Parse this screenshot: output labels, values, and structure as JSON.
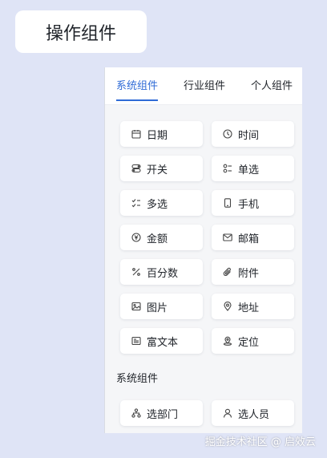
{
  "header": {
    "title": "操作组件"
  },
  "tabs": [
    {
      "label": "系统组件",
      "active": true
    },
    {
      "label": "行业组件",
      "active": false
    },
    {
      "label": "个人组件",
      "active": false
    }
  ],
  "components": [
    {
      "label": "日期",
      "icon": "calendar-icon"
    },
    {
      "label": "时间",
      "icon": "clock-icon"
    },
    {
      "label": "开关",
      "icon": "toggle-icon"
    },
    {
      "label": "单选",
      "icon": "radio-icon"
    },
    {
      "label": "多选",
      "icon": "checkbox-icon"
    },
    {
      "label": "手机",
      "icon": "phone-icon"
    },
    {
      "label": "金额",
      "icon": "yen-icon"
    },
    {
      "label": "邮箱",
      "icon": "mail-icon"
    },
    {
      "label": "百分数",
      "icon": "percent-icon"
    },
    {
      "label": "附件",
      "icon": "paperclip-icon"
    },
    {
      "label": "图片",
      "icon": "image-icon"
    },
    {
      "label": "地址",
      "icon": "location-icon"
    },
    {
      "label": "富文本",
      "icon": "rich-text-icon"
    },
    {
      "label": "定位",
      "icon": "map-pin-icon"
    }
  ],
  "section2": {
    "title": "系统组件",
    "items": [
      {
        "label": "选部门",
        "icon": "org-icon"
      },
      {
        "label": "选人员",
        "icon": "person-icon"
      }
    ]
  },
  "watermark": "掘金技术社区 @ 启效云",
  "colors": {
    "accent": "#2f6bd6",
    "background": "#dfe4f6",
    "panel": "#f5f6f8"
  }
}
